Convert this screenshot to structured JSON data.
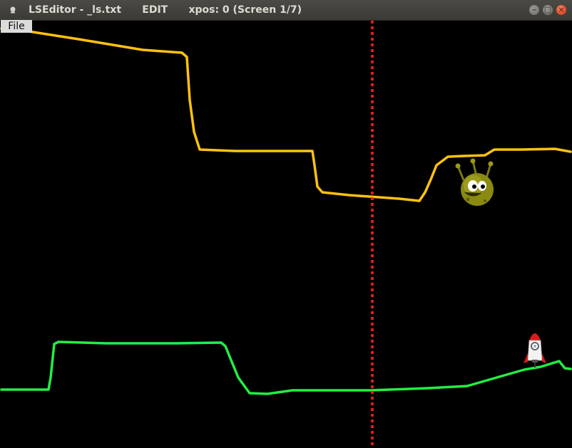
{
  "window": {
    "title": "LSEditor - _ls.txt      EDIT      xpos: 0 (Screen 1/7)",
    "close_glyph": "×",
    "minimize_glyph": "–",
    "maximize_glyph": "□"
  },
  "menubar": {
    "file_label": "File"
  },
  "colors": {
    "top_line": "#ffc20e",
    "bottom_line": "#22ee44",
    "marker": "#ff1e1e",
    "background": "#000000"
  },
  "icons": {
    "alien": "alien-icon",
    "rocket": "rocket-icon"
  }
}
